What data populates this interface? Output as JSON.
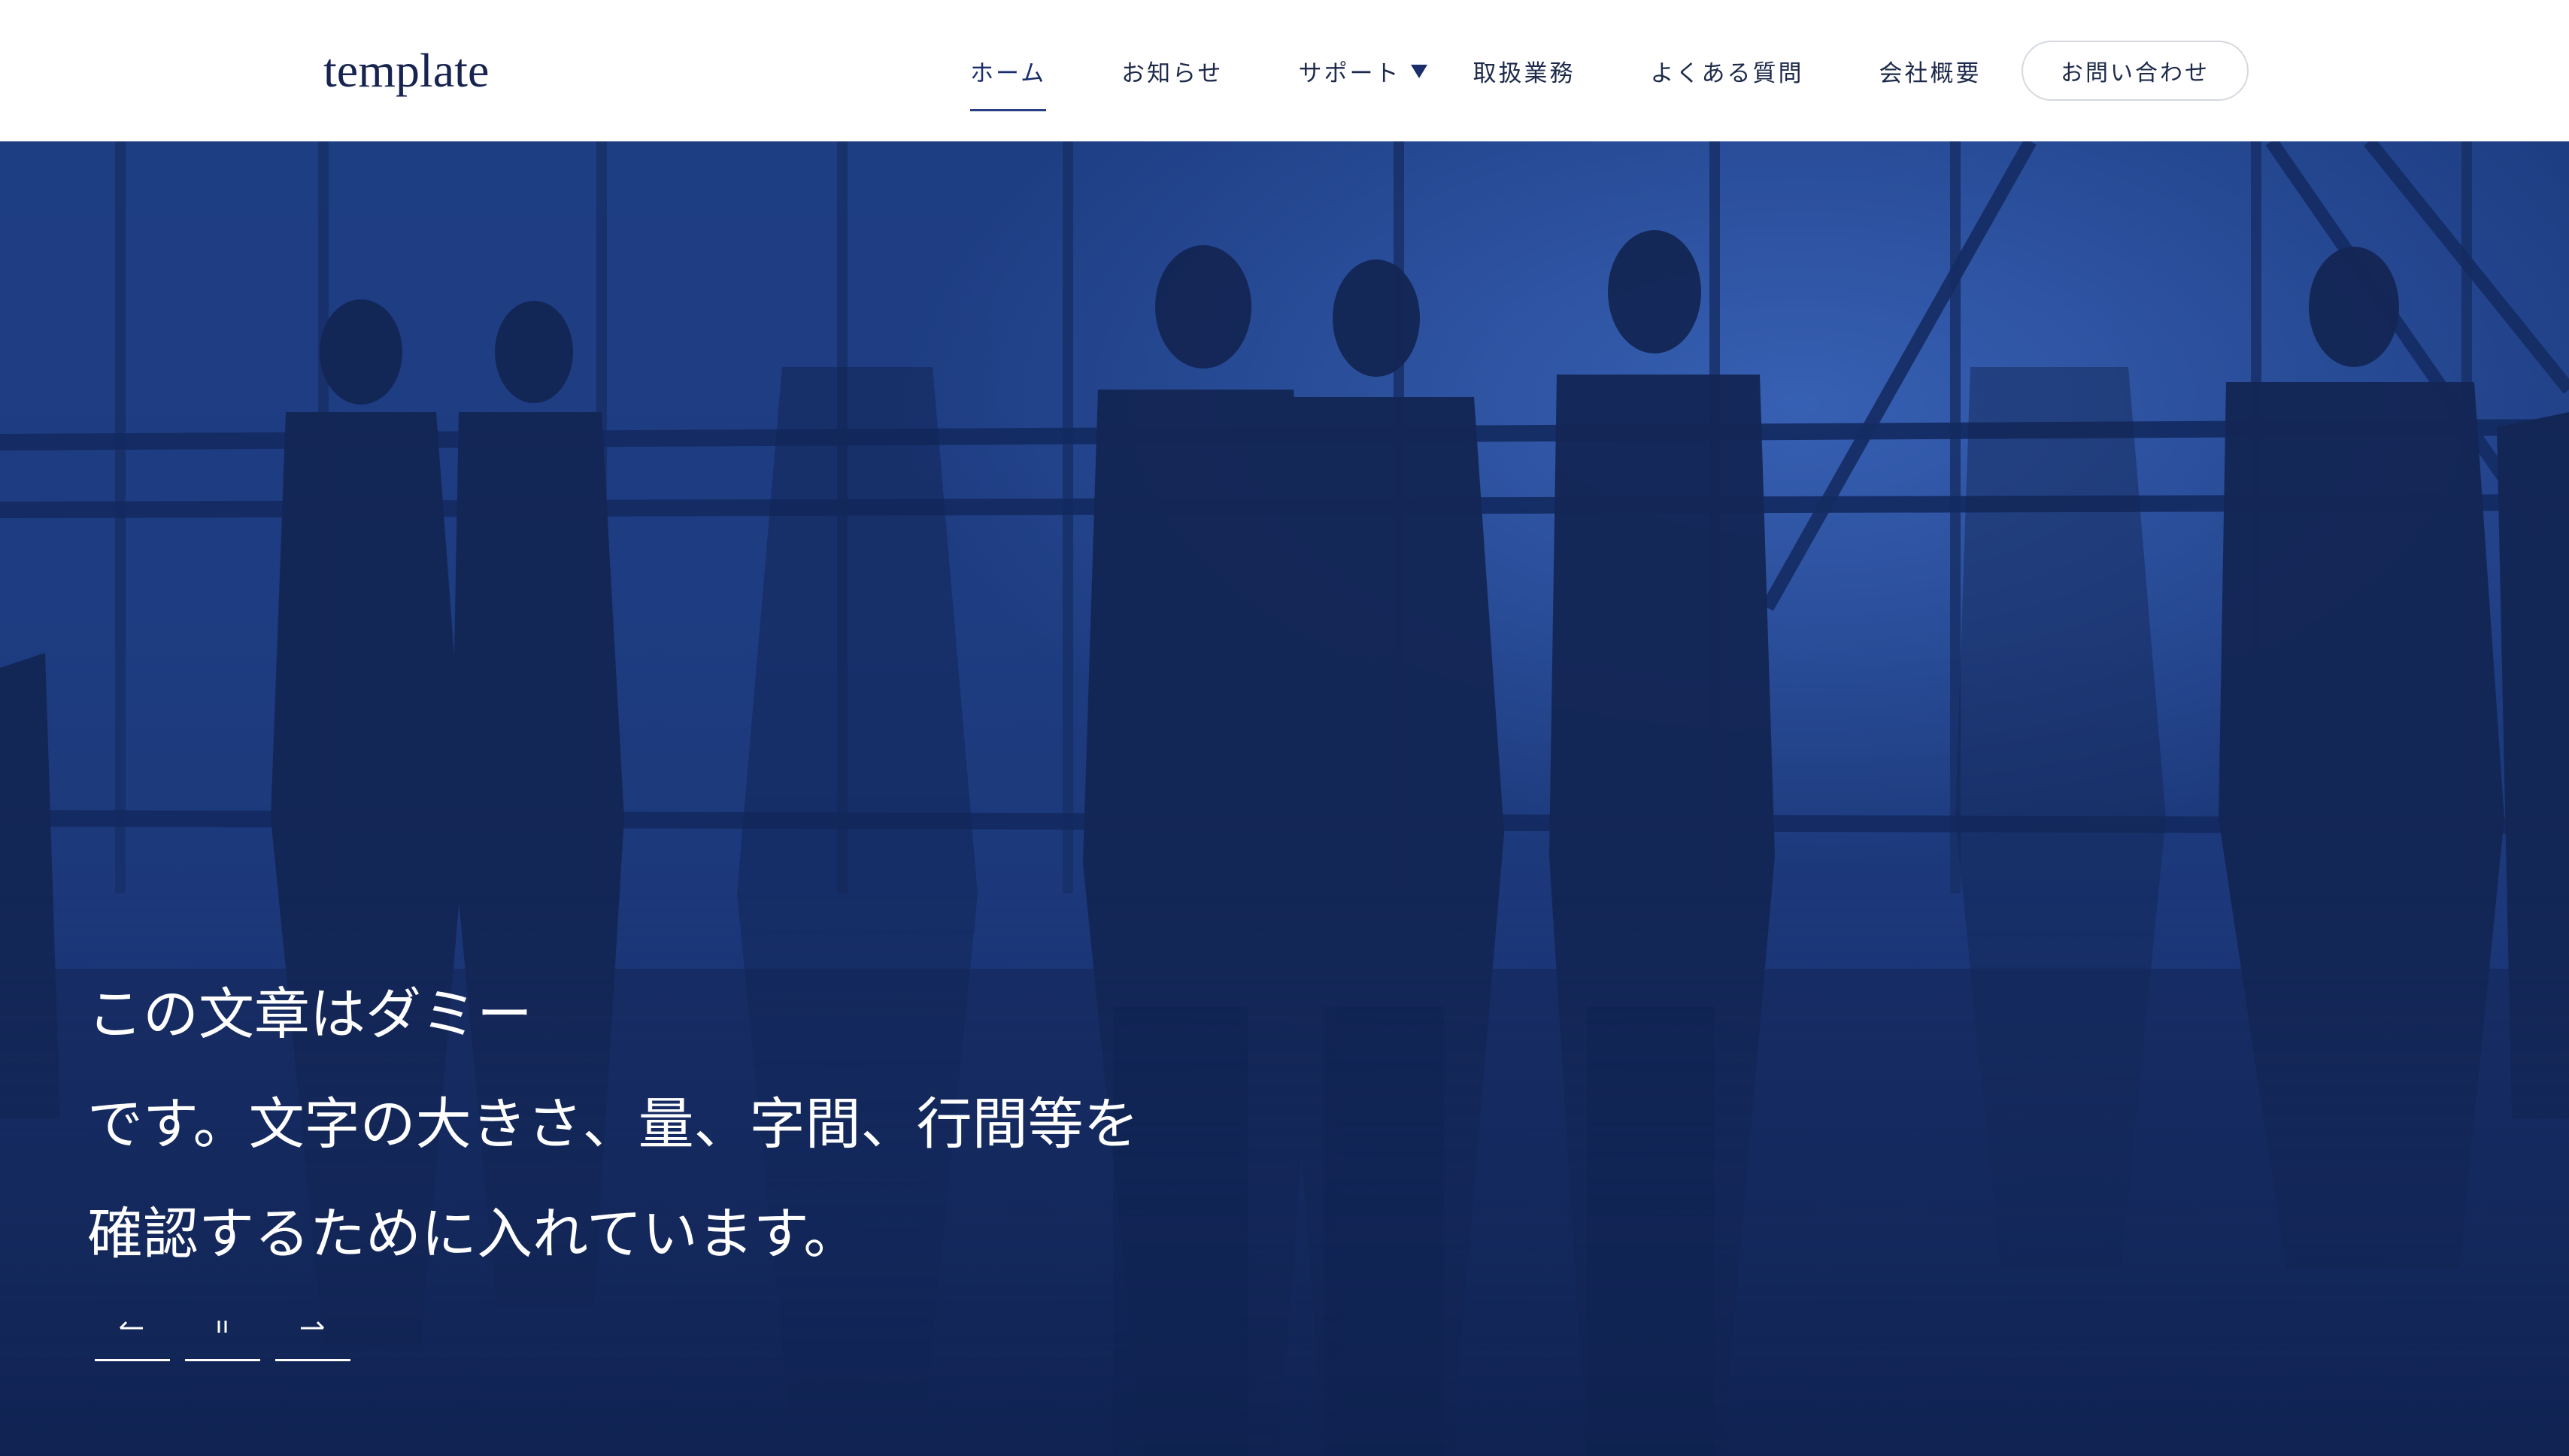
{
  "header": {
    "logo": "template",
    "nav": [
      {
        "label": "ホーム",
        "active": true
      },
      {
        "label": "お知らせ",
        "active": false
      },
      {
        "label": "サポート",
        "active": false,
        "has_dropdown": true
      },
      {
        "label": "取扱業務",
        "active": false
      },
      {
        "label": "よくある質問",
        "active": false
      },
      {
        "label": "会社概要",
        "active": false
      }
    ],
    "contact_label": "お問い合わせ"
  },
  "hero": {
    "headline_lines": [
      "この文章はダミー",
      "です。文字の大きさ、量、字間、行間等を",
      "確認するために入れています。"
    ],
    "controls": {
      "prev_icon": "arrow-left-icon",
      "pause_icon": "pause-icon",
      "next_icon": "arrow-right-icon"
    }
  },
  "colors": {
    "brand_navy": "#17244f",
    "hero_blue": "#1b3676",
    "nav_underline": "#2a3f86",
    "header_bg": "#ffffff"
  }
}
